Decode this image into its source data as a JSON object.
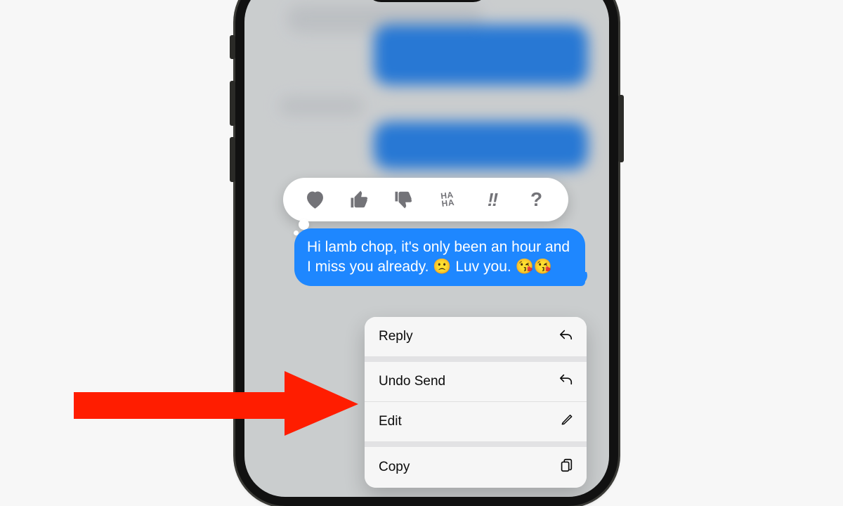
{
  "colors": {
    "accent": "#1e87ff",
    "menu_bg": "#f4f4f4",
    "arrow": "#ff1d00"
  },
  "tapbacks": [
    {
      "name": "heart-icon"
    },
    {
      "name": "thumbs-up-icon"
    },
    {
      "name": "thumbs-down-icon"
    },
    {
      "name": "haha-icon",
      "label": "HA HA"
    },
    {
      "name": "exclaim-icon",
      "label": "!!"
    },
    {
      "name": "question-icon",
      "label": "?"
    }
  ],
  "message": {
    "text": "Hi lamb chop, it's only been an hour and I miss you already. 🙁 Luv you. 😘😘"
  },
  "context_menu": {
    "items": [
      {
        "label": "Reply",
        "icon": "reply-icon"
      },
      {
        "label": "Undo Send",
        "icon": "undo-icon"
      },
      {
        "label": "Edit",
        "icon": "edit-icon"
      },
      {
        "label": "Copy",
        "icon": "copy-icon"
      }
    ]
  },
  "annotation": {
    "arrow_color": "#ff1d00",
    "points_to": "undo-send-item"
  }
}
